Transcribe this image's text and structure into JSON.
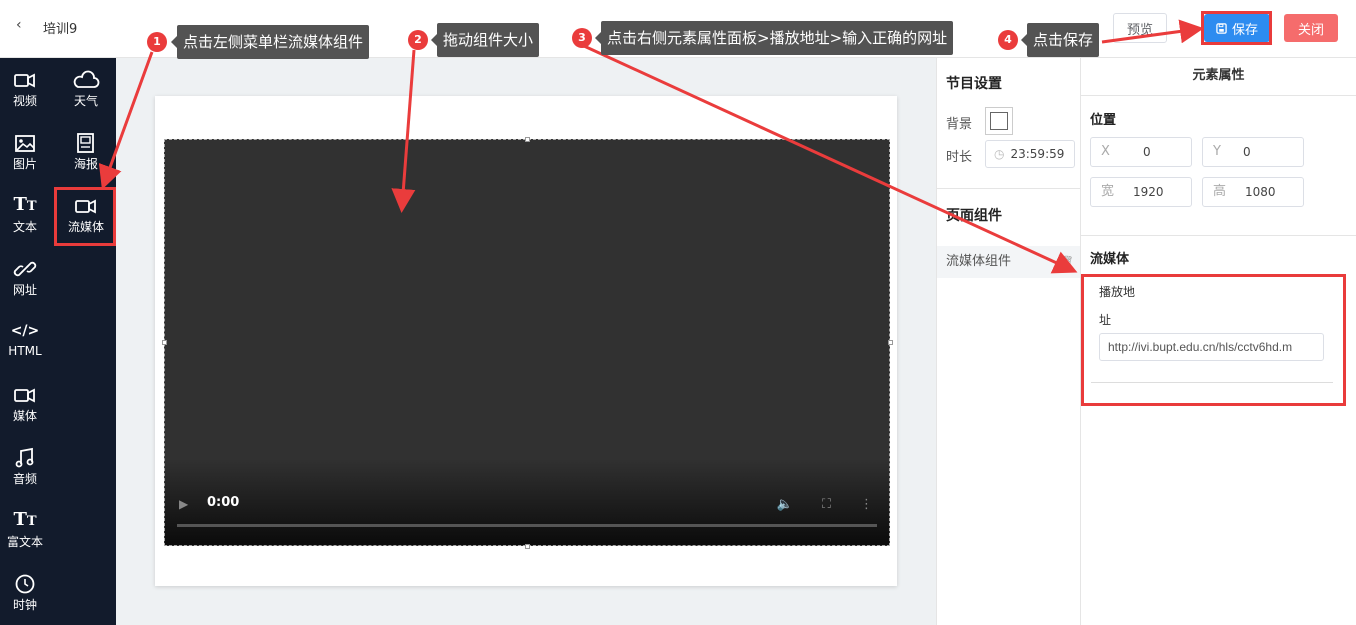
{
  "header": {
    "back_icon": "chevron-left-icon",
    "title": "培训9",
    "preview_label": "预览",
    "save_label": "保存",
    "close_label": "关闭"
  },
  "sidebar": {
    "items": [
      {
        "label": "视频",
        "icon": "video-icon"
      },
      {
        "label": "天气",
        "icon": "cloud-icon"
      },
      {
        "label": "图片",
        "icon": "image-icon"
      },
      {
        "label": "海报",
        "icon": "poster-icon"
      },
      {
        "label": "文本",
        "icon": "text-icon"
      },
      {
        "label": "流媒体",
        "icon": "stream-icon"
      },
      {
        "label": "网址",
        "icon": "link-icon"
      },
      {
        "label": "HTML",
        "icon": "code-icon"
      },
      {
        "label": "媒体",
        "icon": "media-icon"
      },
      {
        "label": "音频",
        "icon": "music-icon"
      },
      {
        "label": "富文本",
        "icon": "richtext-icon"
      },
      {
        "label": "时钟",
        "icon": "clock-icon"
      }
    ]
  },
  "video": {
    "time": "0:00"
  },
  "program": {
    "title": "节目设置",
    "bg_label": "背景",
    "duration_label": "时长",
    "duration_value": "23:59:59",
    "components_title": "页面组件",
    "component_item": "流媒体组件"
  },
  "properties": {
    "title": "元素属性",
    "position_title": "位置",
    "x_label": "X",
    "x_value": "0",
    "y_label": "Y",
    "y_value": "0",
    "w_label": "宽",
    "w_value": "1920",
    "h_label": "高",
    "h_value": "1080",
    "stream_title": "流媒体",
    "play_label_line1": "播放地",
    "play_label_line2": "址",
    "url_value": "http://ivi.bupt.edu.cn/hls/cctv6hd.m"
  },
  "annotations": [
    {
      "num": "1",
      "text": "点击左侧菜单栏流媒体组件"
    },
    {
      "num": "2",
      "text": "拖动组件大小"
    },
    {
      "num": "3",
      "text": "点击右侧元素属性面板>播放地址>输入正确的网址"
    },
    {
      "num": "4",
      "text": "点击保存"
    }
  ],
  "colors": {
    "sidebar_bg": "#121b2c",
    "primary": "#2d8cf0",
    "danger": "#f56c6c",
    "annotation_red": "#ea3c3c"
  }
}
